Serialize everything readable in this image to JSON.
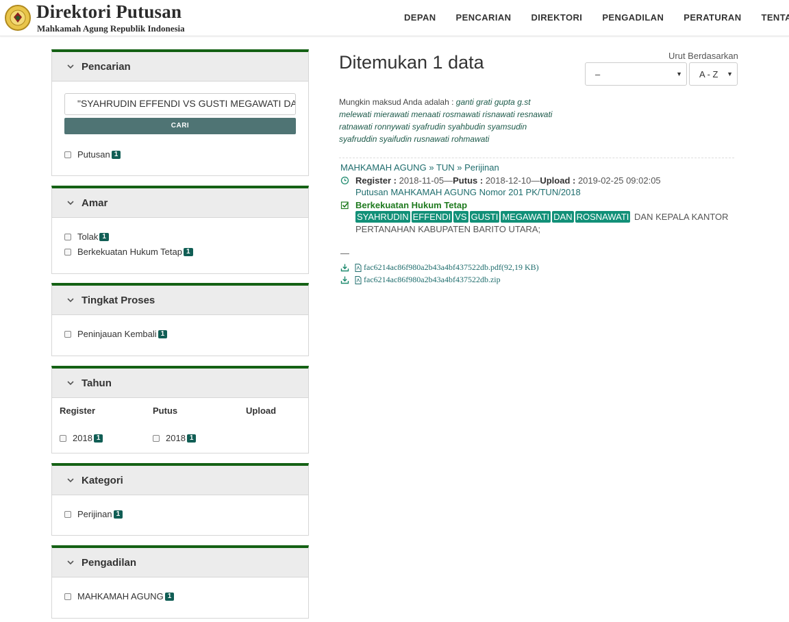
{
  "header": {
    "title": "Direktori Putusan",
    "subtitle": "Mahkamah Agung Republik Indonesia",
    "nav": [
      "DEPAN",
      "PENCARIAN",
      "DIREKTORI",
      "PENGADILAN",
      "PERATURAN",
      "TENTANG"
    ]
  },
  "sidebar": {
    "search": {
      "title": "Pencarian",
      "query": "\"SYAHRUDIN EFFENDI VS GUSTI MEGAWATI DAN ROSNAWATI\"",
      "button": "CARI",
      "options": [
        {
          "label": "Putusan",
          "count": "1"
        }
      ]
    },
    "amar": {
      "title": "Amar",
      "options": [
        {
          "label": "Tolak",
          "count": "1"
        },
        {
          "label": "Berkekuatan Hukum Tetap",
          "count": "1"
        }
      ]
    },
    "tingkat": {
      "title": "Tingkat Proses",
      "options": [
        {
          "label": "Peninjauan Kembali",
          "count": "1"
        }
      ]
    },
    "tahun": {
      "title": "Tahun",
      "columns": [
        "Register",
        "Putus",
        "Upload"
      ],
      "register": {
        "label": "2018",
        "count": "1"
      },
      "putus": {
        "label": "2018",
        "count": "1"
      }
    },
    "kategori": {
      "title": "Kategori",
      "options": [
        {
          "label": "Perijinan",
          "count": "1"
        }
      ]
    },
    "pengadilan": {
      "title": "Pengadilan",
      "options": [
        {
          "label": "MAHKAMAH AGUNG",
          "count": "1"
        }
      ]
    }
  },
  "main": {
    "title": "Ditemukan 1 data",
    "sort_label": "Urut Berdasarkan",
    "sort_field": "–",
    "sort_order": "A - Z",
    "suggest_prefix": "Mungkin maksud Anda adalah :",
    "suggest_words": "ganti grati gupta g.st melewati mierawati menaati rosmawati risnawati resnawati ratnawati ronnywati syafrudin syahbudin syamsudin syafruddin syaifudin rusnawati rohmawati",
    "result": {
      "crumb_1": "MAHKAMAH AGUNG",
      "crumb_2": "TUN",
      "crumb_3": "Perijinan",
      "register_label": "Register :",
      "register_value": "2018-11-05",
      "putus_label": "Putus :",
      "putus_value": "2018-12-10",
      "upload_label": "Upload :",
      "upload_value": "2019-02-25 09:02:05",
      "nomor": "Putusan MAHKAMAH AGUNG Nomor 201 PK/TUN/2018",
      "status": "Berkekuatan Hukum Tetap",
      "highlights": [
        "SYAHRUDIN",
        "EFFENDI",
        "VS",
        "GUSTI",
        "MEGAWATI",
        "DAN",
        "ROSNAWATI"
      ],
      "rest": "DAN KEPALA KANTOR PERTANAHAN KABUPATEN BARITO UTARA;",
      "dash": "—",
      "files": [
        "fac6214ac86f980a2b43a4bf437522db.pdf(92,19 KB)",
        "fac6214ac86f980a2b43a4bf437522db.zip"
      ]
    }
  },
  "colors": {
    "panel_top": "#146114",
    "badge": "#115e55",
    "highlight": "#129078",
    "button": "#4f7474",
    "link": "#1f6d6d",
    "status": "#1e7a1e"
  }
}
